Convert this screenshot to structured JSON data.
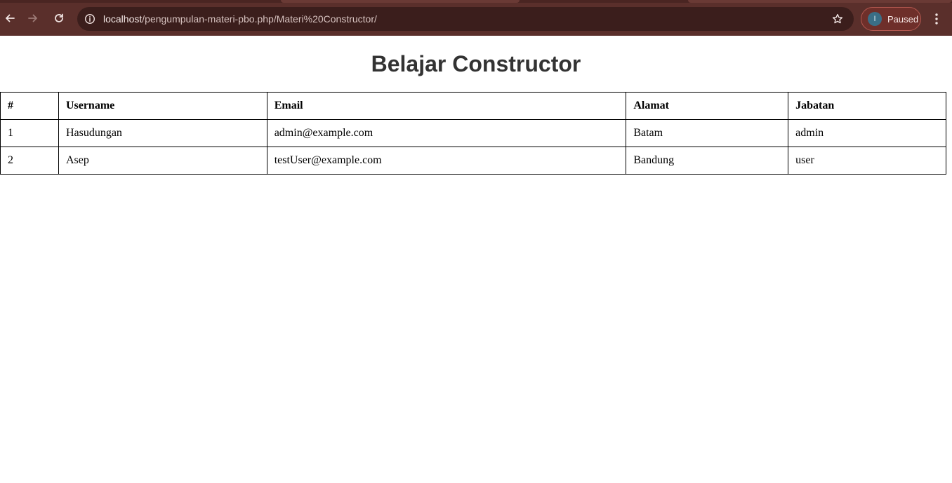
{
  "browser": {
    "url_host": "localhost",
    "url_path": "/pengumpulan-materi-pbo.php/Materi%20Constructor/",
    "profile_initial": "I",
    "profile_status": "Paused",
    "icons": {
      "back": "arrow-left-icon",
      "forward": "arrow-right-icon",
      "reload": "reload-icon",
      "site_info": "info-icon",
      "bookmark": "star-icon",
      "menu": "kebab-menu-icon"
    },
    "colors": {
      "toolbar": "#5a2f2b",
      "omnibox": "#3b1e1c",
      "profile_chip": "#6e2f2a",
      "avatar": "#3a6e86"
    }
  },
  "page": {
    "title": "Belajar Constructor",
    "table": {
      "headers": [
        "#",
        "Username",
        "Email",
        "Alamat",
        "Jabatan"
      ],
      "rows": [
        [
          "1",
          "Hasudungan",
          "admin@example.com",
          "Batam",
          "admin"
        ],
        [
          "2",
          "Asep",
          "testUser@example.com",
          "Bandung",
          "user"
        ]
      ]
    }
  }
}
